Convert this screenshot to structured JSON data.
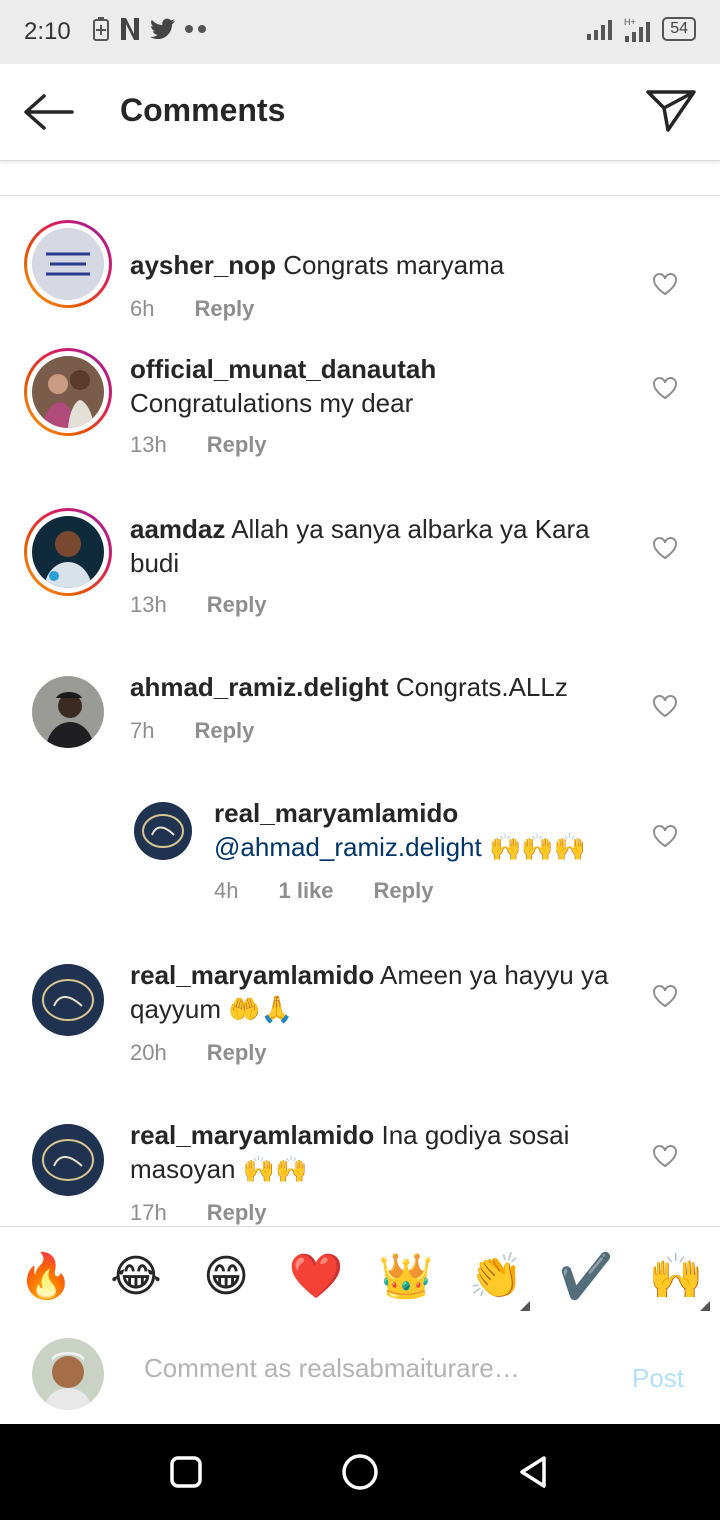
{
  "status_bar": {
    "time": "2:10",
    "battery": "54",
    "left_icons": [
      "battery-saver-icon",
      "netflix-icon",
      "twitter-icon",
      "more-dots-icon"
    ],
    "right_icons": [
      "signal-icon",
      "hplus-signal-icon",
      "battery-icon"
    ]
  },
  "app_bar": {
    "title": "Comments",
    "back_icon": "arrow-left-icon",
    "share_icon": "send-icon"
  },
  "comments": [
    {
      "username": "aysher_nop",
      "text": "Congrats maryama",
      "time": "6h",
      "likes": "",
      "reply_label": "Reply"
    },
    {
      "username": "official_munat_danautah",
      "text": "Congratulations my dear",
      "time": "13h",
      "likes": "",
      "reply_label": "Reply"
    },
    {
      "username": "aamdaz",
      "text": "Allah ya sanya albarka ya Kara budi",
      "time": "13h",
      "likes": "",
      "reply_label": "Reply"
    },
    {
      "username": "ahmad_ramiz.delight",
      "text": "Congrats.ALLz",
      "time": "7h",
      "likes": "",
      "reply_label": "Reply"
    },
    {
      "username": "real_maryamlamido",
      "mention": "@ahmad_ramiz.delight",
      "text": "🙌🙌🙌",
      "time": "4h",
      "likes": "1 like",
      "reply_label": "Reply"
    },
    {
      "username": "real_maryamlamido",
      "text": "Ameen ya hayyu ya qayyum 🤲🙏",
      "time": "20h",
      "likes": "",
      "reply_label": "Reply"
    },
    {
      "username": "real_maryamlamido",
      "text": "Ina godiya sosai masoyan 🙌🙌",
      "time": "17h",
      "likes": "",
      "reply_label": "Reply"
    }
  ],
  "emoji_bar": [
    "🔥",
    "😂",
    "😁",
    "❤️",
    "👑",
    "👏",
    "✔️",
    "🙌"
  ],
  "composer": {
    "placeholder": "Comment as realsabmaiturare…",
    "post_label": "Post"
  },
  "colors": {
    "accent": "#0095f6",
    "post_disabled": "#b2dffc",
    "meta_gray": "#8e8e8e",
    "mention": "#003569"
  },
  "nav_bar": [
    "recents-icon",
    "home-icon",
    "back-icon"
  ]
}
